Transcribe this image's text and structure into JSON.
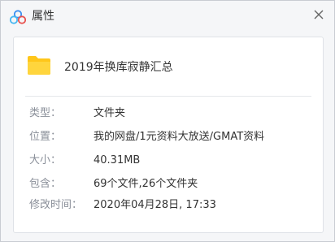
{
  "window": {
    "title": "属性",
    "app_icon": "cloud-logo-icon",
    "close_icon": "close-icon"
  },
  "file": {
    "icon": "folder-icon",
    "name": "2019年换库寂静汇总"
  },
  "properties": [
    {
      "label": "类型：",
      "value": "文件夹"
    },
    {
      "label": "位置：",
      "value": "我的网盘/1元资料大放送/GMAT资料"
    },
    {
      "label": "大小：",
      "value": "40.31MB"
    },
    {
      "label": "包含：",
      "value": "69个文件,26个文件夹"
    },
    {
      "label": "修改时间：",
      "value": "2020年04月28日, 17:33"
    }
  ],
  "colors": {
    "accent_blue": "#3b8ff0",
    "folder_yellow": "#ffc61a",
    "label_gray": "#8a8f99",
    "text_dark": "#333333"
  }
}
